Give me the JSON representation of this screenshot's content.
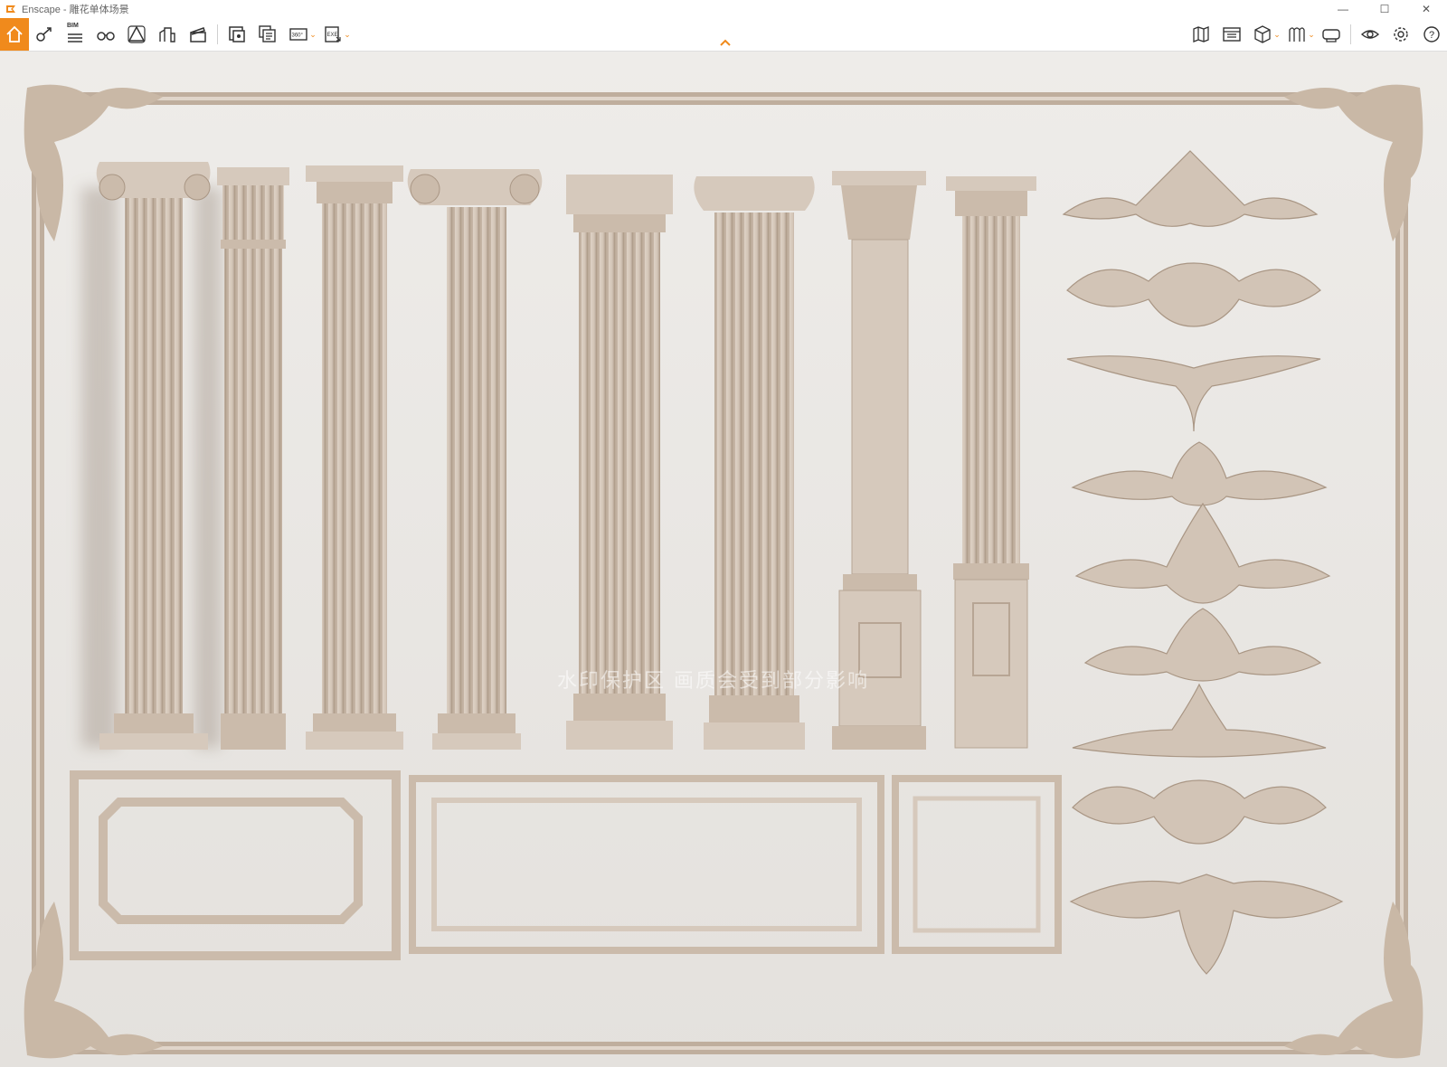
{
  "window": {
    "title": "Enscape - 雕花单体场景",
    "controls": {
      "minimize": "—",
      "maximize": "☐",
      "close": "✕"
    }
  },
  "toolbar": {
    "bim_label": "BIM",
    "pano_label": "360°",
    "exe_label": "EXE",
    "left_icons": [
      "home-icon",
      "view-icon",
      "bim-icon",
      "binoculars-icon",
      "safe-frame-icon",
      "building-icon",
      "clapper-icon",
      "screenshot-icon",
      "batch-render-icon",
      "panorama-icon",
      "export-exe-icon"
    ],
    "right_icons": [
      "map-icon",
      "asset-library-icon",
      "cube-icon",
      "materials-icon",
      "vr-headset-icon",
      "visual-settings-icon",
      "settings-icon",
      "help-icon"
    ],
    "help_label": "?"
  },
  "viewport": {
    "watermark": "水印保护区 画质会受到部分影响"
  },
  "colors": {
    "accent": "#f08a1c",
    "molding": "#d6c9bc",
    "molding_shadow": "#a99684",
    "wall": "#ebe8e4"
  }
}
